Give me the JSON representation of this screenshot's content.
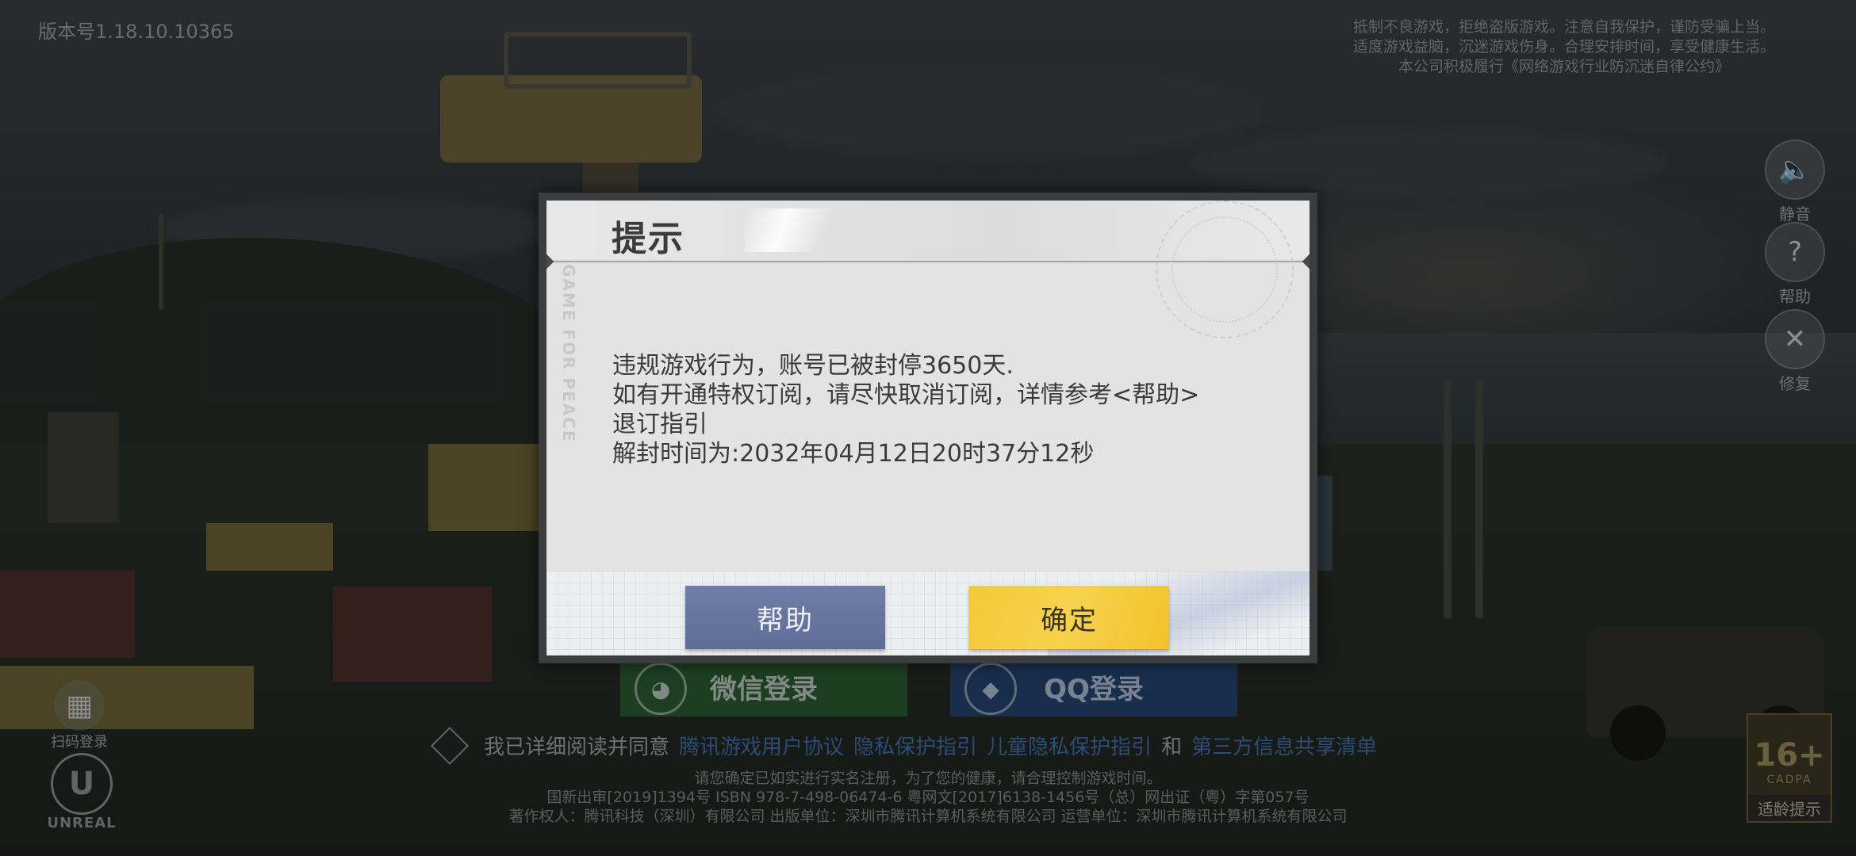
{
  "top": {
    "version": "版本号1.18.10.10365",
    "health_notice": [
      "抵制不良游戏，拒绝盗版游戏。注意自我保护，谨防受骗上当。",
      "适度游戏益脑，沉迷游戏伤身。合理安排时间，享受健康生活。",
      "本公司积极履行《网络游戏行业防沉迷自律公约》"
    ]
  },
  "side_buttons": [
    {
      "label": "静音",
      "icon": "speaker-icon"
    },
    {
      "label": "帮助",
      "icon": "help-icon"
    },
    {
      "label": "修复",
      "icon": "repair-icon"
    }
  ],
  "bottom_left": {
    "scan_login": "扫码登录",
    "engine": "UNREAL"
  },
  "login": {
    "wechat": "微信登录",
    "qq": "QQ登录",
    "agree_prefix": "我已详细阅读并同意",
    "agree_links": [
      "腾讯游戏用户协议",
      "隐私保护指引",
      "儿童隐私保护指引"
    ],
    "agree_and": "和",
    "agree_last": "第三方信息共享清单"
  },
  "legal": [
    "请您确定已如实进行实名注册，为了您的健康，请合理控制游戏时间。",
    "国新出审[2019]1394号  ISBN 978-7-498-06474-6  粤网文[2017]6138-1456号（总）网出证（粤）字第057号",
    "著作权人：腾讯科技（深圳）有限公司  出版单位：深圳市腾讯计算机系统有限公司  运营单位：深圳市腾讯计算机系统有限公司"
  ],
  "age_badge": {
    "age": "16+",
    "org": "CADPA",
    "label": "适龄提示"
  },
  "dialog": {
    "title": "提示",
    "watermark": "GAME FOR PEACE",
    "lines": [
      "违规游戏行为，账号已被封停3650天.",
      "如有开通特权订阅，请尽快取消订阅，详情参考<帮助>",
      "退订指引",
      "解封时间为:2032年04月12日20时37分12秒"
    ],
    "help_button": "帮助",
    "ok_button": "确定"
  },
  "colors": {
    "help_button": "#6372a0",
    "ok_button": "#f4c937",
    "link": "#3f6ea8"
  }
}
